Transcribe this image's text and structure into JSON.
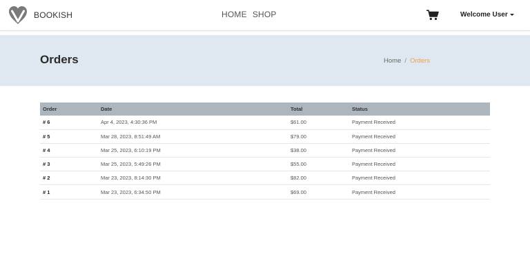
{
  "navbar": {
    "brand": "BOOKISH",
    "links": [
      "HOME",
      "SHOP"
    ],
    "cart_icon": "shopping-cart-icon",
    "user_menu": "Welcome User"
  },
  "header": {
    "title": "Orders",
    "breadcrumb": {
      "home": "Home",
      "separator": "/",
      "current": "Orders"
    }
  },
  "orders": {
    "columns": [
      "Order",
      "Date",
      "Total",
      "Status"
    ],
    "rows": [
      {
        "order": "# 6",
        "date": "Apr 4, 2023, 4:30:36 PM",
        "total": "$61.00",
        "status": "Payment Received"
      },
      {
        "order": "# 5",
        "date": "Mar 28, 2023, 8:51:49 AM",
        "total": "$79.00",
        "status": "Payment Received"
      },
      {
        "order": "# 4",
        "date": "Mar 25, 2023, 6:10:19 PM",
        "total": "$38.00",
        "status": "Payment Received"
      },
      {
        "order": "# 3",
        "date": "Mar 25, 2023, 5:49:26 PM",
        "total": "$55.00",
        "status": "Payment Received"
      },
      {
        "order": "# 2",
        "date": "Mar 23, 2023, 8:14:30 PM",
        "total": "$82.00",
        "status": "Payment Received"
      },
      {
        "order": "# 1",
        "date": "Mar 23, 2023, 6:34:50 PM",
        "total": "$69.00",
        "status": "Payment Received"
      }
    ]
  },
  "colors": {
    "header_band": "#dfe8f0",
    "table_header": "#adb5bd",
    "breadcrumb_active": "#e8a14a"
  }
}
